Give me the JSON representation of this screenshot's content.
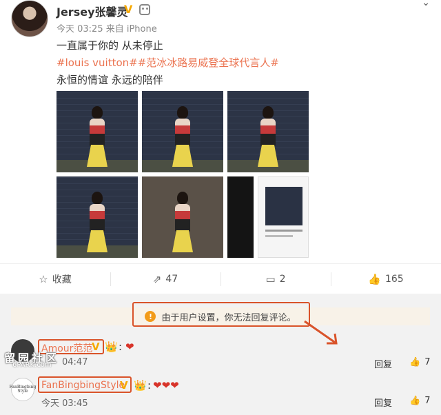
{
  "post": {
    "username": "Jersey张馨灵",
    "verified_badge": "V",
    "meta": "今天 03:25 来自 iPhone",
    "line1": "一直属于你的 从未停止",
    "hashtags": "#louis vuitton##范冰冰路易威登全球代言人#",
    "line3": "永恒的情谊 永远的陪伴",
    "icons": {
      "more": "chevron-down-icon",
      "robot": "robot-icon"
    }
  },
  "actions": {
    "collect_label": "收藏",
    "repost_count": "47",
    "comment_count": "2",
    "like_count": "165"
  },
  "comments_section": {
    "notice": "由于用户设置，你无法回复评论。",
    "watermark": "留园社区",
    "watermark_sub": "6PARK.com",
    "comments": [
      {
        "name": "Amour范范",
        "badge": "V",
        "time": "04:47",
        "reply": "回复",
        "likes": "7"
      },
      {
        "name": "FanBingbingStyle",
        "badge": "V",
        "time": "今天 03:45",
        "reply": "回复",
        "likes": "7",
        "avatar_text": "FanBingbing Style"
      }
    ]
  },
  "colors": {
    "accent": "#eb7350",
    "highlight_box": "#d9532a",
    "notice_bg": "#f8f2e8",
    "badge": "#f6a800"
  }
}
